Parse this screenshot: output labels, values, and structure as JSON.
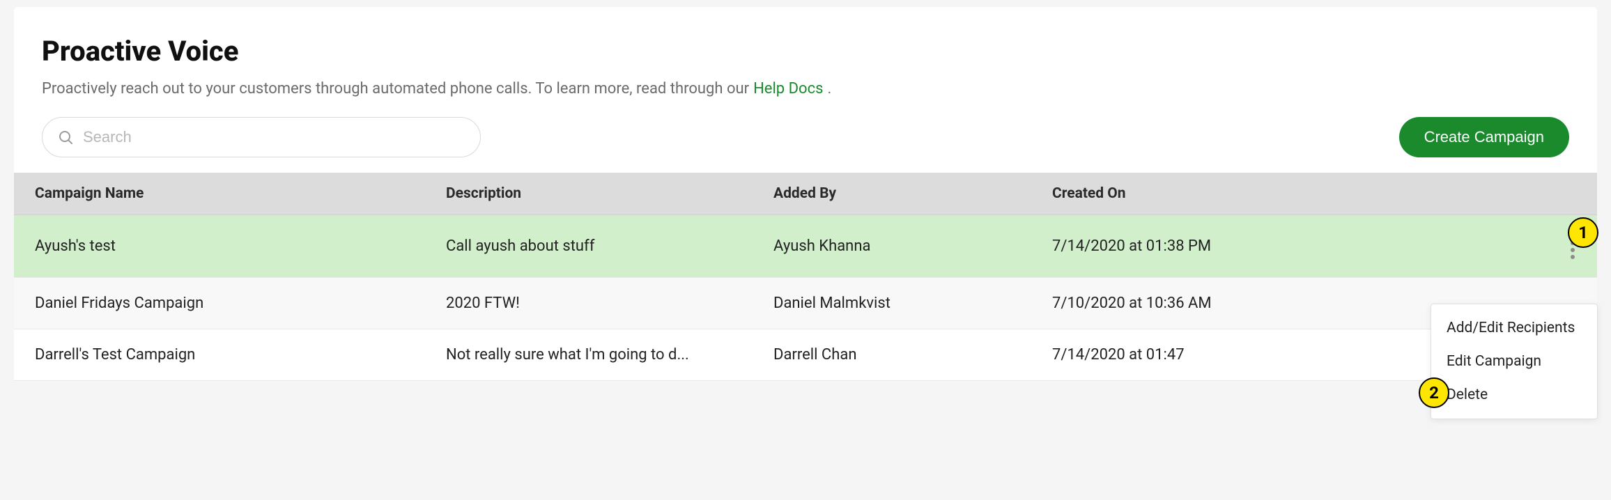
{
  "header": {
    "title": "Proactive Voice",
    "subtitle_prefix": "Proactively reach out to your customers through automated phone calls. To learn more, read through our ",
    "help_link_text": "Help Docs",
    "subtitle_suffix": "."
  },
  "toolbar": {
    "search_placeholder": "Search",
    "create_button_label": "Create Campaign"
  },
  "table": {
    "columns": {
      "name": "Campaign Name",
      "description": "Description",
      "added_by": "Added By",
      "created_on": "Created On"
    },
    "rows": [
      {
        "name": "Ayush's test",
        "description": "Call ayush about stuff",
        "added_by": "Ayush Khanna",
        "created_on": "7/14/2020 at 01:38 PM",
        "highlighted": true,
        "show_more": true
      },
      {
        "name": "Daniel Fridays Campaign",
        "description": "2020 FTW!",
        "added_by": "Daniel Malmkvist",
        "created_on": "7/10/2020 at 10:36 AM"
      },
      {
        "name": "Darrell's Test Campaign",
        "description": "Not really sure what I'm going to d...",
        "added_by": "Darrell Chan",
        "created_on": "7/14/2020 at 01:47"
      }
    ]
  },
  "dropdown": {
    "items": [
      {
        "label": "Add/Edit Recipients"
      },
      {
        "label": "Edit Campaign"
      },
      {
        "label": "Delete"
      }
    ]
  },
  "annotations": {
    "one": "1",
    "two": "2"
  }
}
